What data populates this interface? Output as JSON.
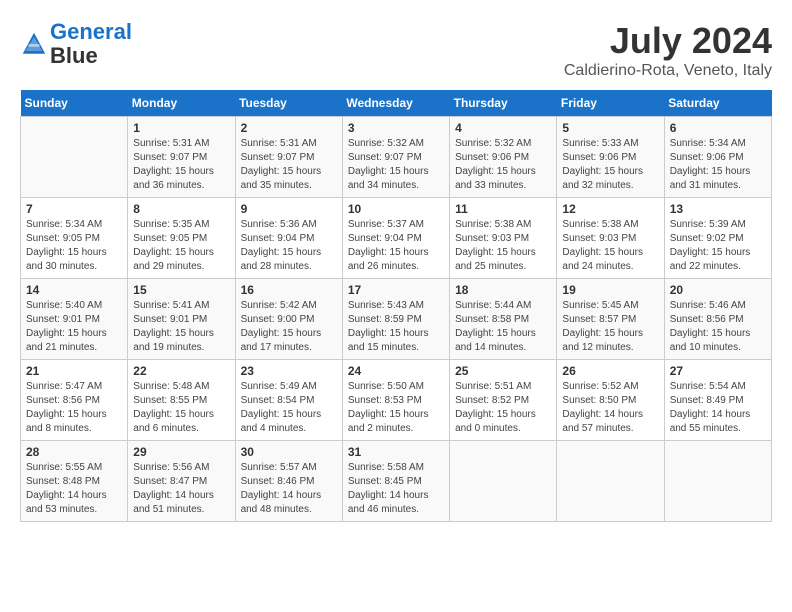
{
  "header": {
    "logo_line1": "General",
    "logo_line2": "Blue",
    "title": "July 2024",
    "subtitle": "Caldierino-Rota, Veneto, Italy"
  },
  "days_of_week": [
    "Sunday",
    "Monday",
    "Tuesday",
    "Wednesday",
    "Thursday",
    "Friday",
    "Saturday"
  ],
  "weeks": [
    [
      {
        "day": "",
        "info": ""
      },
      {
        "day": "1",
        "info": "Sunrise: 5:31 AM\nSunset: 9:07 PM\nDaylight: 15 hours\nand 36 minutes."
      },
      {
        "day": "2",
        "info": "Sunrise: 5:31 AM\nSunset: 9:07 PM\nDaylight: 15 hours\nand 35 minutes."
      },
      {
        "day": "3",
        "info": "Sunrise: 5:32 AM\nSunset: 9:07 PM\nDaylight: 15 hours\nand 34 minutes."
      },
      {
        "day": "4",
        "info": "Sunrise: 5:32 AM\nSunset: 9:06 PM\nDaylight: 15 hours\nand 33 minutes."
      },
      {
        "day": "5",
        "info": "Sunrise: 5:33 AM\nSunset: 9:06 PM\nDaylight: 15 hours\nand 32 minutes."
      },
      {
        "day": "6",
        "info": "Sunrise: 5:34 AM\nSunset: 9:06 PM\nDaylight: 15 hours\nand 31 minutes."
      }
    ],
    [
      {
        "day": "7",
        "info": "Sunrise: 5:34 AM\nSunset: 9:05 PM\nDaylight: 15 hours\nand 30 minutes."
      },
      {
        "day": "8",
        "info": "Sunrise: 5:35 AM\nSunset: 9:05 PM\nDaylight: 15 hours\nand 29 minutes."
      },
      {
        "day": "9",
        "info": "Sunrise: 5:36 AM\nSunset: 9:04 PM\nDaylight: 15 hours\nand 28 minutes."
      },
      {
        "day": "10",
        "info": "Sunrise: 5:37 AM\nSunset: 9:04 PM\nDaylight: 15 hours\nand 26 minutes."
      },
      {
        "day": "11",
        "info": "Sunrise: 5:38 AM\nSunset: 9:03 PM\nDaylight: 15 hours\nand 25 minutes."
      },
      {
        "day": "12",
        "info": "Sunrise: 5:38 AM\nSunset: 9:03 PM\nDaylight: 15 hours\nand 24 minutes."
      },
      {
        "day": "13",
        "info": "Sunrise: 5:39 AM\nSunset: 9:02 PM\nDaylight: 15 hours\nand 22 minutes."
      }
    ],
    [
      {
        "day": "14",
        "info": "Sunrise: 5:40 AM\nSunset: 9:01 PM\nDaylight: 15 hours\nand 21 minutes."
      },
      {
        "day": "15",
        "info": "Sunrise: 5:41 AM\nSunset: 9:01 PM\nDaylight: 15 hours\nand 19 minutes."
      },
      {
        "day": "16",
        "info": "Sunrise: 5:42 AM\nSunset: 9:00 PM\nDaylight: 15 hours\nand 17 minutes."
      },
      {
        "day": "17",
        "info": "Sunrise: 5:43 AM\nSunset: 8:59 PM\nDaylight: 15 hours\nand 15 minutes."
      },
      {
        "day": "18",
        "info": "Sunrise: 5:44 AM\nSunset: 8:58 PM\nDaylight: 15 hours\nand 14 minutes."
      },
      {
        "day": "19",
        "info": "Sunrise: 5:45 AM\nSunset: 8:57 PM\nDaylight: 15 hours\nand 12 minutes."
      },
      {
        "day": "20",
        "info": "Sunrise: 5:46 AM\nSunset: 8:56 PM\nDaylight: 15 hours\nand 10 minutes."
      }
    ],
    [
      {
        "day": "21",
        "info": "Sunrise: 5:47 AM\nSunset: 8:56 PM\nDaylight: 15 hours\nand 8 minutes."
      },
      {
        "day": "22",
        "info": "Sunrise: 5:48 AM\nSunset: 8:55 PM\nDaylight: 15 hours\nand 6 minutes."
      },
      {
        "day": "23",
        "info": "Sunrise: 5:49 AM\nSunset: 8:54 PM\nDaylight: 15 hours\nand 4 minutes."
      },
      {
        "day": "24",
        "info": "Sunrise: 5:50 AM\nSunset: 8:53 PM\nDaylight: 15 hours\nand 2 minutes."
      },
      {
        "day": "25",
        "info": "Sunrise: 5:51 AM\nSunset: 8:52 PM\nDaylight: 15 hours\nand 0 minutes."
      },
      {
        "day": "26",
        "info": "Sunrise: 5:52 AM\nSunset: 8:50 PM\nDaylight: 14 hours\nand 57 minutes."
      },
      {
        "day": "27",
        "info": "Sunrise: 5:54 AM\nSunset: 8:49 PM\nDaylight: 14 hours\nand 55 minutes."
      }
    ],
    [
      {
        "day": "28",
        "info": "Sunrise: 5:55 AM\nSunset: 8:48 PM\nDaylight: 14 hours\nand 53 minutes."
      },
      {
        "day": "29",
        "info": "Sunrise: 5:56 AM\nSunset: 8:47 PM\nDaylight: 14 hours\nand 51 minutes."
      },
      {
        "day": "30",
        "info": "Sunrise: 5:57 AM\nSunset: 8:46 PM\nDaylight: 14 hours\nand 48 minutes."
      },
      {
        "day": "31",
        "info": "Sunrise: 5:58 AM\nSunset: 8:45 PM\nDaylight: 14 hours\nand 46 minutes."
      },
      {
        "day": "",
        "info": ""
      },
      {
        "day": "",
        "info": ""
      },
      {
        "day": "",
        "info": ""
      }
    ]
  ]
}
